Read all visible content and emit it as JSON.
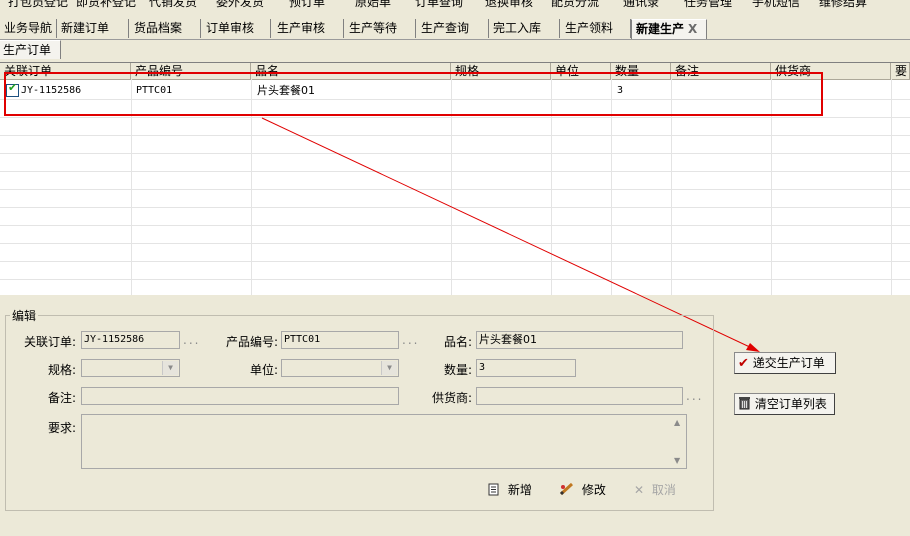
{
  "colors": {
    "accent_red": "#e00000",
    "check_green": "#21a121"
  },
  "top_menu": [
    "打包员登记",
    "即货补登记",
    "代销发货",
    "委外发货",
    "预订单",
    "原始单",
    "订单查询",
    "退换审核",
    "配货分流",
    "通讯录",
    "任务管理",
    "手机短信",
    "维修结算"
  ],
  "tabs": [
    "业务导航",
    "新建订单",
    "货品档案",
    "订单审核",
    "生产审核",
    "生产等待",
    "生产查询",
    "完工入库",
    "生产领料",
    "新建生产"
  ],
  "tab_close": "X",
  "subtab": "生产订单",
  "grid": {
    "columns": [
      "关联订单",
      "产品编号",
      "品名",
      "规格",
      "单位",
      "数量",
      "备注",
      "供货商",
      "要"
    ],
    "rows": [
      {
        "checked": true,
        "order": "JY-1152586",
        "code": "PTTC01",
        "name": "片头套餐01",
        "spec": "",
        "unit": "",
        "qty": "3",
        "note": "",
        "supplier": ""
      }
    ]
  },
  "edit": {
    "title": "编辑",
    "labels": {
      "order": "关联订单:",
      "code": "产品编号:",
      "name": "品名:",
      "spec": "规格:",
      "unit": "单位:",
      "qty": "数量:",
      "note": "备注:",
      "supplier": "供货商:",
      "req": "要求:"
    },
    "values": {
      "order": "JY-1152586",
      "code": "PTTC01",
      "name": "片头套餐01",
      "spec": "",
      "unit": "",
      "qty": "3",
      "note": "",
      "supplier": "",
      "req": ""
    },
    "ellipsis": "...",
    "buttons": {
      "new": "新增",
      "modify": "修改",
      "cancel": "取消"
    }
  },
  "side_buttons": {
    "submit": "递交生产订单",
    "clear": "清空订单列表"
  },
  "icons": [
    "check-icon",
    "new-doc-icon",
    "edit-pencil-icon",
    "cancel-x-icon",
    "trash-icon",
    "chevron-down-icon",
    "arrow-icon"
  ]
}
